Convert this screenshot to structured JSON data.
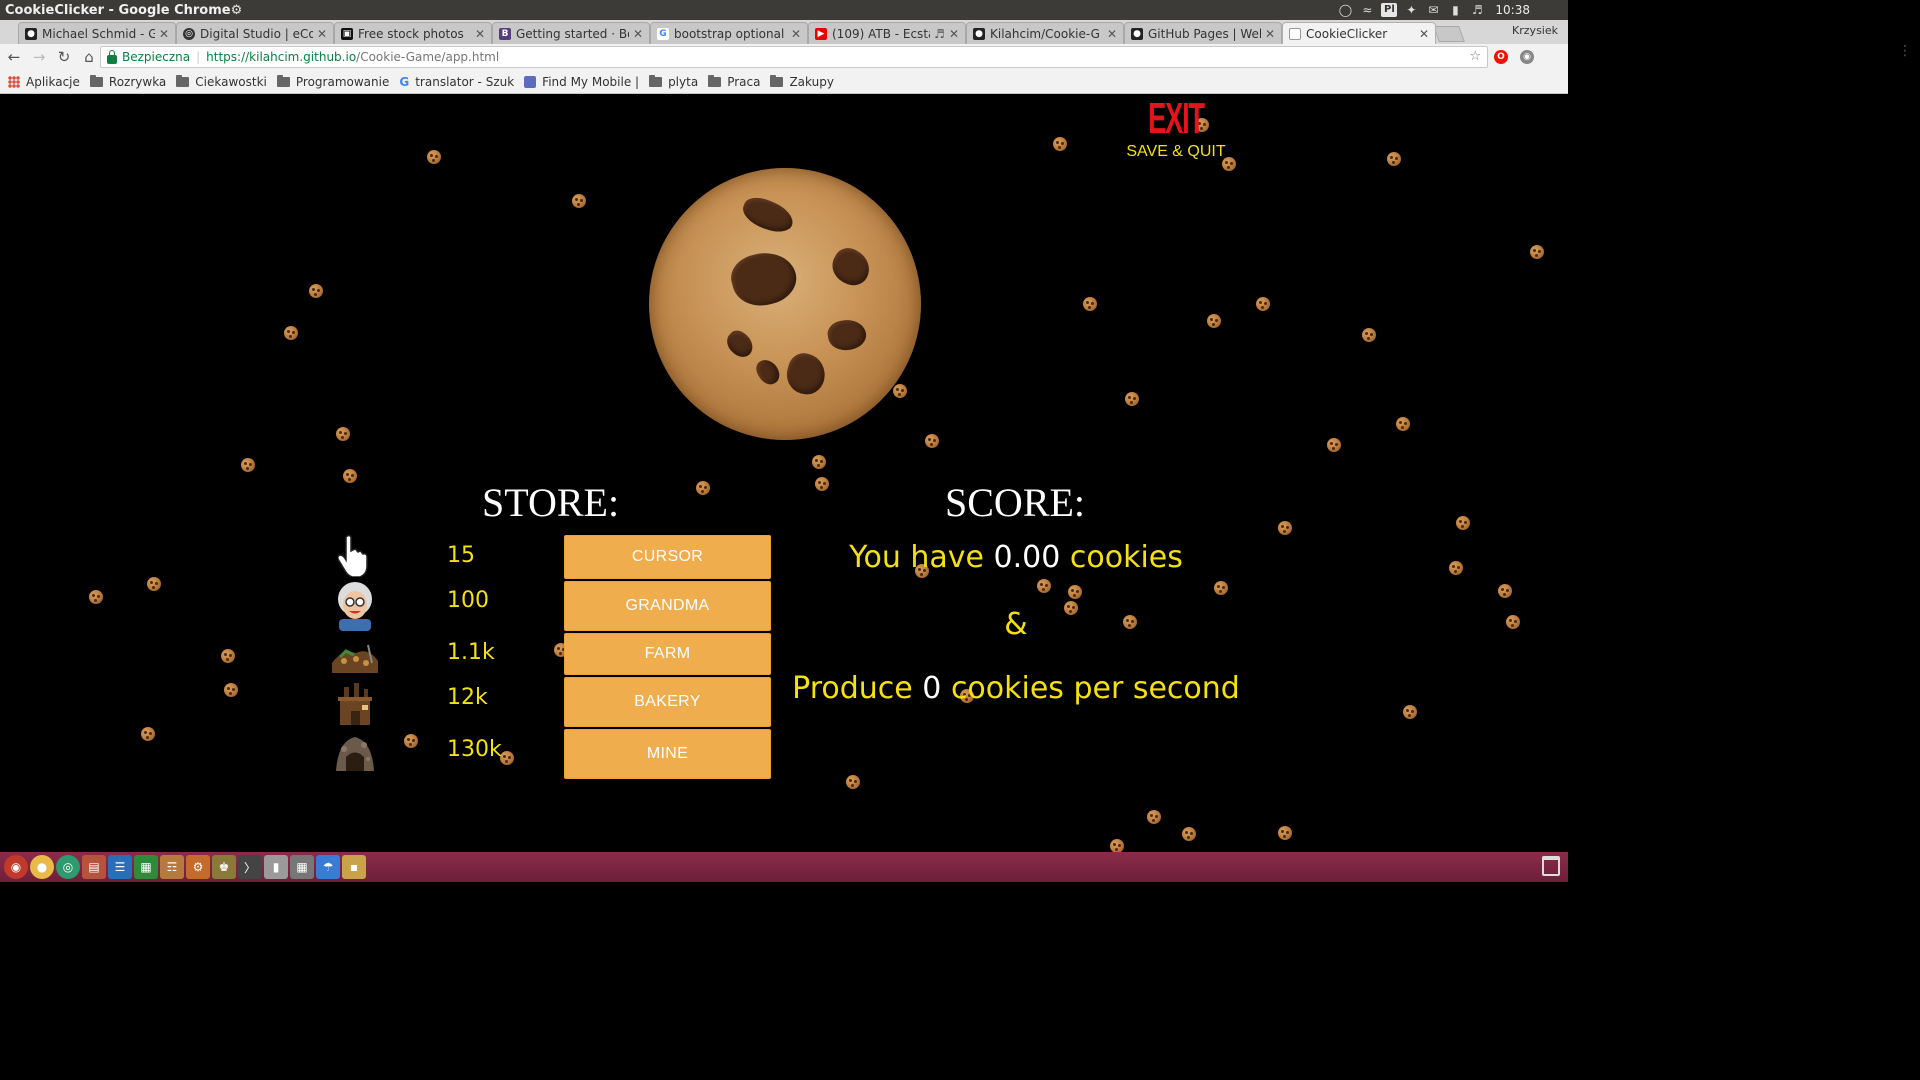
{
  "window": {
    "title": "CookieClicker - Google Chrome"
  },
  "system_tray": {
    "keyboard_layout": "Pl",
    "clock": "10:38",
    "user": "Krzysiek"
  },
  "tabs": [
    {
      "label": "Michael Schmid - G",
      "icon": "github-icon",
      "active": false
    },
    {
      "label": "Digital Studio | eCo",
      "icon": "target-icon",
      "active": false
    },
    {
      "label": "Free stock photos",
      "icon": "camera-icon",
      "active": false
    },
    {
      "label": "Getting started · Bo",
      "icon": "bootstrap-icon",
      "active": false
    },
    {
      "label": "bootstrap optional",
      "icon": "google-icon",
      "active": false
    },
    {
      "label": "(109) ATB - Ecsta",
      "icon": "youtube-icon",
      "active": false
    },
    {
      "label": "Kilahcim/Cookie-G",
      "icon": "github-icon",
      "active": false
    },
    {
      "label": "GitHub Pages | Web",
      "icon": "github-icon",
      "active": false
    },
    {
      "label": "CookieClicker",
      "icon": "page-icon",
      "active": true
    }
  ],
  "address_bar": {
    "secure_label": "Bezpieczna",
    "url_host": "https://kilahcim.github.io",
    "url_path": "/Cookie-Game/app.html"
  },
  "bookmarks": [
    {
      "label": "Aplikacje",
      "icon": "apps-icon"
    },
    {
      "label": "Rozrywka",
      "icon": "folder-icon"
    },
    {
      "label": "Ciekawostki",
      "icon": "folder-icon"
    },
    {
      "label": "Programowanie",
      "icon": "folder-icon"
    },
    {
      "label": "translator - Szuk",
      "icon": "google-icon"
    },
    {
      "label": "Find My Mobile |",
      "icon": "samsung-icon"
    },
    {
      "label": "plyta",
      "icon": "folder-icon"
    },
    {
      "label": "Praca",
      "icon": "folder-icon"
    },
    {
      "label": "Zakupy",
      "icon": "folder-icon"
    }
  ],
  "game": {
    "exit_label": "EXIT",
    "save_quit_label": "SAVE & QUIT",
    "store_heading": "STORE:",
    "score_heading": "SCORE:",
    "store_items": [
      {
        "name": "CURSOR",
        "price": "15",
        "icon": "cursor-hand-icon"
      },
      {
        "name": "GRANDMA",
        "price": "100",
        "icon": "grandma-icon"
      },
      {
        "name": "FARM",
        "price": "1.1k",
        "icon": "farm-icon"
      },
      {
        "name": "BAKERY",
        "price": "12k",
        "icon": "bakery-icon"
      },
      {
        "name": "MINE",
        "price": "130k",
        "icon": "mine-icon"
      }
    ],
    "score": {
      "have_prefix": "You have",
      "cookies_count": "0.00",
      "have_suffix": "cookies",
      "ampersand": "&",
      "produce_prefix": "Produce",
      "per_second_count": "0",
      "produce_suffix": "cookies per second"
    }
  },
  "colors": {
    "exit_red": "#e3141b",
    "score_yellow": "#f5e012",
    "button_orange": "#f0ad4e",
    "taskbar": "#7a2542"
  }
}
